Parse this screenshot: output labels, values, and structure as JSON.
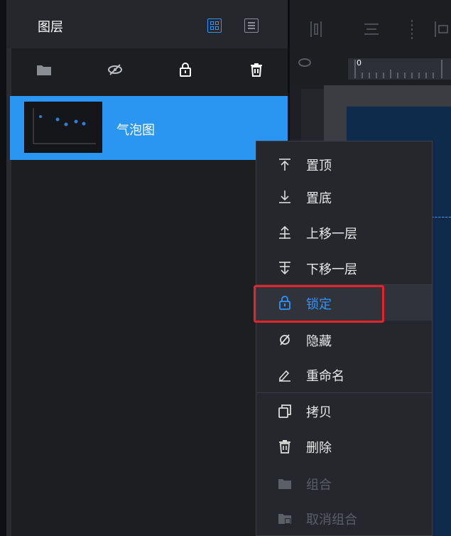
{
  "layers_panel": {
    "title": "图层",
    "layers": [
      {
        "name": "气泡图"
      }
    ]
  },
  "context_menu": {
    "items": [
      {
        "label": "置顶",
        "icon": "move-to-top-icon"
      },
      {
        "label": "置底",
        "icon": "move-to-bottom-icon"
      },
      {
        "label": "上移一层",
        "icon": "move-up-icon"
      },
      {
        "label": "下移一层",
        "icon": "move-down-icon"
      },
      {
        "label": "锁定",
        "icon": "lock-icon"
      },
      {
        "label": "隐藏",
        "icon": "hide-icon"
      },
      {
        "label": "重命名",
        "icon": "rename-icon"
      },
      {
        "label": "拷贝",
        "icon": "copy-icon"
      },
      {
        "label": "删除",
        "icon": "delete-icon"
      },
      {
        "label": "组合",
        "icon": "group-icon"
      },
      {
        "label": "取消组合",
        "icon": "ungroup-icon"
      }
    ]
  },
  "ruler": {
    "start_label": "0"
  },
  "colors": {
    "accent": "#2f94ff",
    "selected_row": "#2b96f2",
    "highlight_box": "#e5232a"
  }
}
